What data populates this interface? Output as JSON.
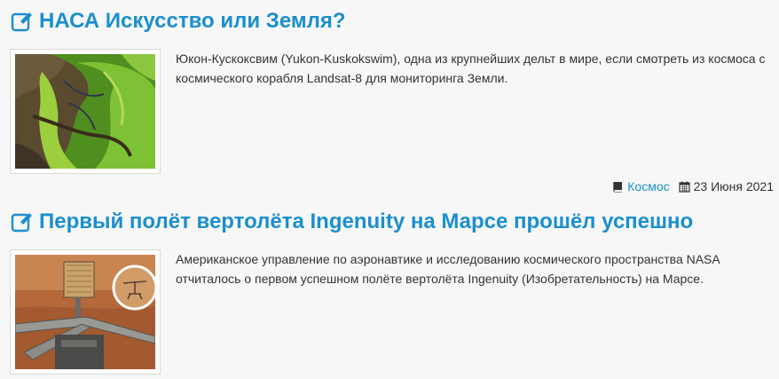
{
  "articles": [
    {
      "title": "НАСА Искусство или Земля?",
      "summary": "Юкон-Кускоксвим (Yukon-Kuskokswim), одна из крупнейших дельт в мире, если смотреть из космоса с космического корабля Landsat-8 для мониторинга Земли.",
      "category": "Космос",
      "date": "23 Июня 2021",
      "title_icon": "edit-icon",
      "image_description_icon": "satellite-delta-image"
    },
    {
      "title": "Первый полёт вертолёта Ingenuity на Марсе прошёл успешно",
      "summary": "Американское управление по аэронавтике и исследованию космического пространства NASA отчиталось о первом успешном полёте вертолёта Ingenuity (Изобретательность) на Марсе.",
      "title_icon": "edit-icon",
      "image_description_icon": "mars-helicopter-image"
    }
  ],
  "colors": {
    "link": "#1a8fcf",
    "text": "#333333",
    "background": "#f7f7f7"
  }
}
